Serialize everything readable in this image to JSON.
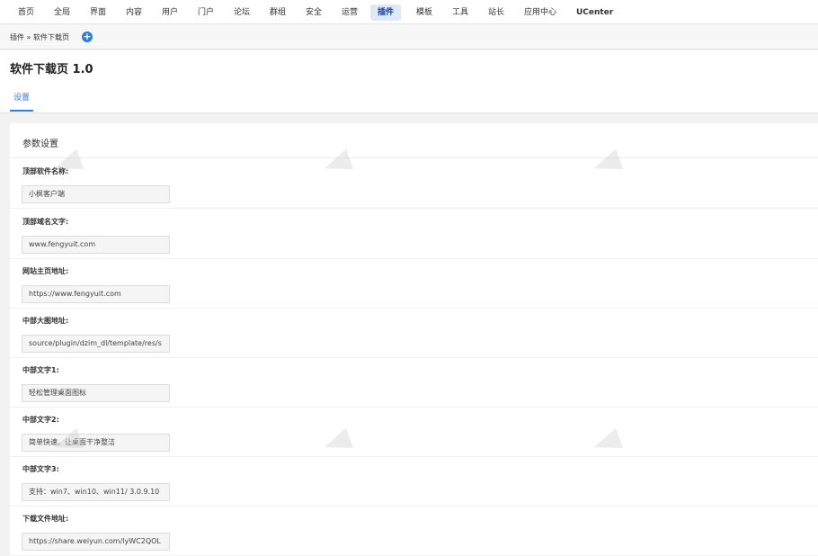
{
  "nav": {
    "items": [
      {
        "label": "首页",
        "active": false
      },
      {
        "label": "全局",
        "active": false
      },
      {
        "label": "界面",
        "active": false
      },
      {
        "label": "内容",
        "active": false
      },
      {
        "label": "用户",
        "active": false
      },
      {
        "label": "门户",
        "active": false
      },
      {
        "label": "论坛",
        "active": false
      },
      {
        "label": "群组",
        "active": false
      },
      {
        "label": "安全",
        "active": false
      },
      {
        "label": "运营",
        "active": false
      },
      {
        "label": "插件",
        "active": true
      },
      {
        "label": "模板",
        "active": false
      },
      {
        "label": "工具",
        "active": false
      },
      {
        "label": "站长",
        "active": false
      },
      {
        "label": "应用中心",
        "active": false
      },
      {
        "label": "UCenter",
        "active": false
      }
    ]
  },
  "breadcrumb": {
    "text": "插件 » 软件下载页",
    "add_icon": "plus-circle-icon"
  },
  "page": {
    "title": "软件下载页 1.0",
    "tab": "设置"
  },
  "panel": {
    "title": "参数设置",
    "fields": [
      {
        "label": "顶部软件名称:",
        "value": "小枫客户端"
      },
      {
        "label": "顶部域名文字:",
        "value": "www.fengyuit.com"
      },
      {
        "label": "网站主页地址:",
        "value": "https://www.fengyuit.com"
      },
      {
        "label": "中部大图地址:",
        "value": "source/plugin/dzim_dl/template/res/s"
      },
      {
        "label": "中部文字1:",
        "value": "轻松管理桌面图标"
      },
      {
        "label": "中部文字2:",
        "value": "简单快速、让桌面干净整洁"
      },
      {
        "label": "中部文字3:",
        "value": "支持：win7、win10、win11/ 3.0.9.10"
      },
      {
        "label": "下载文件地址:",
        "value": "https://share.weiyun.com/lyWC2QOL"
      }
    ]
  },
  "colors": {
    "accent": "#2b7de1",
    "nav_active_bg": "#dfe8f8"
  }
}
